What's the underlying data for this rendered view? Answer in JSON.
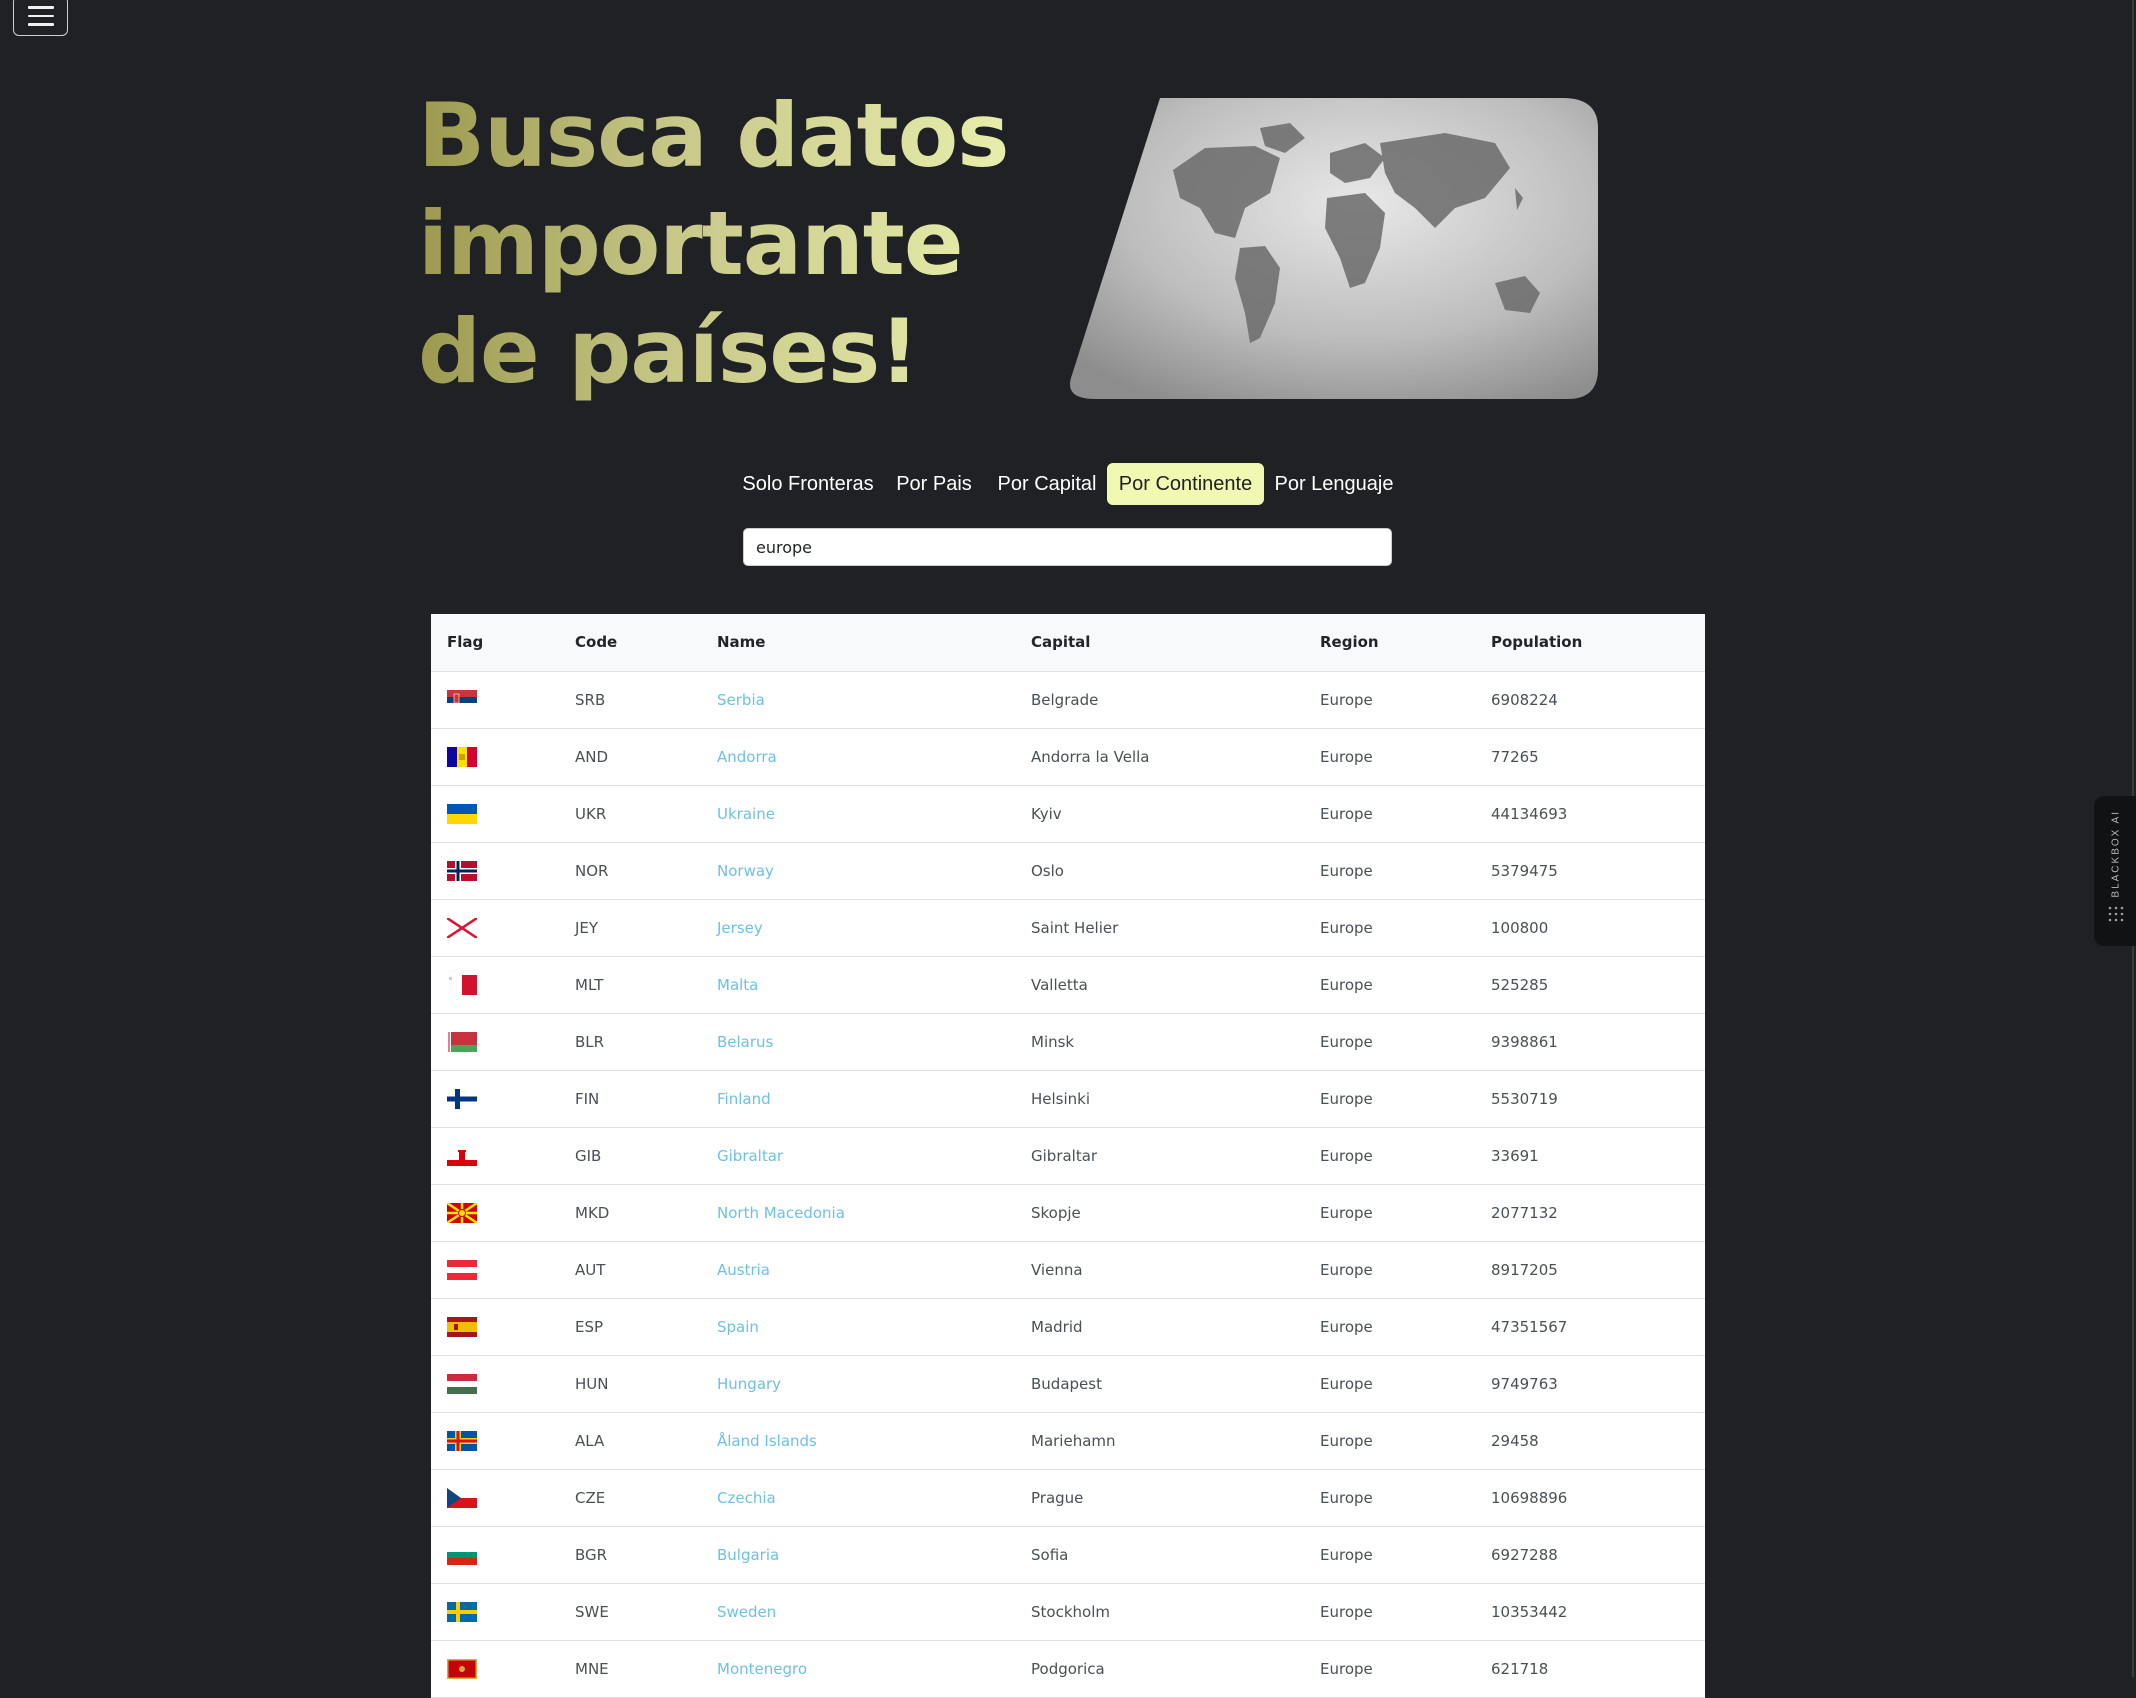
{
  "hero": {
    "title": "Busca datos importante de países!"
  },
  "tabs": [
    {
      "label": "Solo Fronteras",
      "active": false
    },
    {
      "label": "Por Pais",
      "active": false
    },
    {
      "label": "Por Capital",
      "active": false
    },
    {
      "label": "Por Continente",
      "active": true
    },
    {
      "label": "Por Lenguaje",
      "active": false
    }
  ],
  "search": {
    "value": "europe"
  },
  "table": {
    "headers": [
      "Flag",
      "Code",
      "Name",
      "Capital",
      "Region",
      "Population"
    ],
    "rows": [
      {
        "code": "SRB",
        "name": "Serbia",
        "capital": "Belgrade",
        "region": "Europe",
        "population": "6908224",
        "flag": "serbia-flag"
      },
      {
        "code": "AND",
        "name": "Andorra",
        "capital": "Andorra la Vella",
        "region": "Europe",
        "population": "77265",
        "flag": "andorra-flag"
      },
      {
        "code": "UKR",
        "name": "Ukraine",
        "capital": "Kyiv",
        "region": "Europe",
        "population": "44134693",
        "flag": "ukraine-flag"
      },
      {
        "code": "NOR",
        "name": "Norway",
        "capital": "Oslo",
        "region": "Europe",
        "population": "5379475",
        "flag": "norway-flag"
      },
      {
        "code": "JEY",
        "name": "Jersey",
        "capital": "Saint Helier",
        "region": "Europe",
        "population": "100800",
        "flag": "jersey-flag"
      },
      {
        "code": "MLT",
        "name": "Malta",
        "capital": "Valletta",
        "region": "Europe",
        "population": "525285",
        "flag": "malta-flag"
      },
      {
        "code": "BLR",
        "name": "Belarus",
        "capital": "Minsk",
        "region": "Europe",
        "population": "9398861",
        "flag": "belarus-flag"
      },
      {
        "code": "FIN",
        "name": "Finland",
        "capital": "Helsinki",
        "region": "Europe",
        "population": "5530719",
        "flag": "finland-flag"
      },
      {
        "code": "GIB",
        "name": "Gibraltar",
        "capital": "Gibraltar",
        "region": "Europe",
        "population": "33691",
        "flag": "gibraltar-flag"
      },
      {
        "code": "MKD",
        "name": "North Macedonia",
        "capital": "Skopje",
        "region": "Europe",
        "population": "2077132",
        "flag": "north-macedonia-flag"
      },
      {
        "code": "AUT",
        "name": "Austria",
        "capital": "Vienna",
        "region": "Europe",
        "population": "8917205",
        "flag": "austria-flag"
      },
      {
        "code": "ESP",
        "name": "Spain",
        "capital": "Madrid",
        "region": "Europe",
        "population": "47351567",
        "flag": "spain-flag"
      },
      {
        "code": "HUN",
        "name": "Hungary",
        "capital": "Budapest",
        "region": "Europe",
        "population": "9749763",
        "flag": "hungary-flag"
      },
      {
        "code": "ALA",
        "name": "Åland Islands",
        "capital": "Mariehamn",
        "region": "Europe",
        "population": "29458",
        "flag": "aland-islands-flag"
      },
      {
        "code": "CZE",
        "name": "Czechia",
        "capital": "Prague",
        "region": "Europe",
        "population": "10698896",
        "flag": "czechia-flag"
      },
      {
        "code": "BGR",
        "name": "Bulgaria",
        "capital": "Sofia",
        "region": "Europe",
        "population": "6927288",
        "flag": "bulgaria-flag"
      },
      {
        "code": "SWE",
        "name": "Sweden",
        "capital": "Stockholm",
        "region": "Europe",
        "population": "10353442",
        "flag": "sweden-flag"
      },
      {
        "code": "MNE",
        "name": "Montenegro",
        "capital": "Podgorica",
        "region": "Europe",
        "population": "621718",
        "flag": "montenegro-flag"
      }
    ]
  },
  "side_widget": {
    "label": "BLACKBOX AI"
  },
  "colors": {
    "background": "#202124",
    "accent": "#f1f8b2",
    "link": "#6ec1e4"
  }
}
